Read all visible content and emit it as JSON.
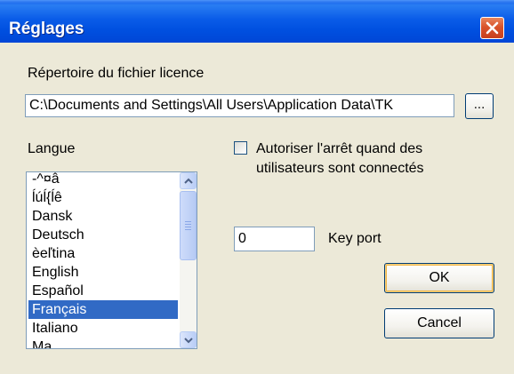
{
  "window": {
    "title": "Réglages"
  },
  "license": {
    "label": "Répertoire du fichier licence",
    "path_value": "C:\\Documents and Settings\\All Users\\Application Data\\TK",
    "browse_label": "..."
  },
  "language": {
    "label": "Langue",
    "items": [
      {
        "label": "-^¤â",
        "selected": false
      },
      {
        "label": "ĺúĺ{ĺê",
        "selected": false
      },
      {
        "label": "Dansk",
        "selected": false
      },
      {
        "label": "Deutsch",
        "selected": false
      },
      {
        "label": "èeľtina",
        "selected": false
      },
      {
        "label": "English",
        "selected": false
      },
      {
        "label": "Español",
        "selected": false
      },
      {
        "label": "Français",
        "selected": true
      },
      {
        "label": "Italiano",
        "selected": false
      },
      {
        "label": "Ma",
        "selected": false
      }
    ],
    "selected_value": "Français"
  },
  "options": {
    "allow_stop_label_line1": "Autoriser l'arrêt quand des",
    "allow_stop_label_line2": "utilisateurs sont connectés",
    "allow_stop_checked": false,
    "key_port_value": "0",
    "key_port_label": "Key port"
  },
  "buttons": {
    "ok_label": "OK",
    "cancel_label": "Cancel"
  },
  "colors": {
    "titlebar": "#0a5ce8",
    "selection": "#316ac5",
    "dialog_bg": "#ece9d8"
  },
  "icons": {
    "close": "close-icon",
    "scroll_up": "chevron-up-icon",
    "scroll_down": "chevron-down-icon"
  }
}
